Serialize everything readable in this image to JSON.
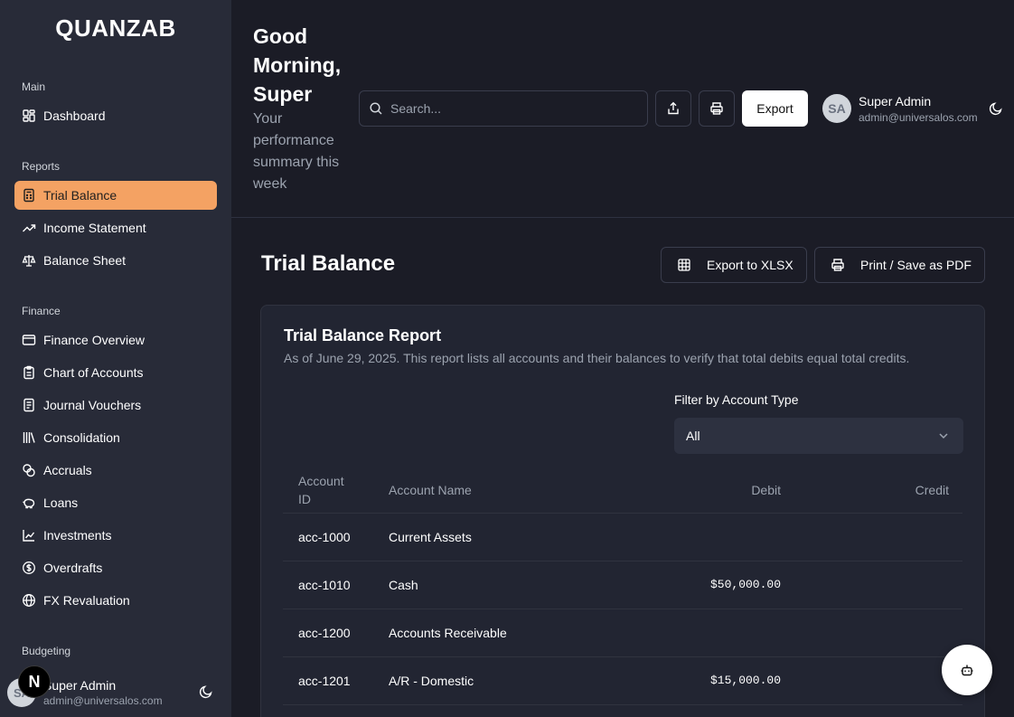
{
  "brand": "QUANZAB",
  "sidebar": {
    "sections": [
      {
        "label": "Main"
      },
      {
        "label": "Reports"
      },
      {
        "label": "Finance"
      },
      {
        "label": "Budgeting"
      }
    ],
    "items": [
      {
        "label": "Dashboard",
        "icon": "dashboard-icon"
      },
      {
        "label": "Trial Balance",
        "icon": "calculator-icon",
        "active": true
      },
      {
        "label": "Income Statement",
        "icon": "trending-up-icon"
      },
      {
        "label": "Balance Sheet",
        "icon": "scale-icon"
      },
      {
        "label": "Finance Overview",
        "icon": "wallet-icon"
      },
      {
        "label": "Chart of Accounts",
        "icon": "clipboard-list-icon"
      },
      {
        "label": "Journal Vouchers",
        "icon": "notebook-icon"
      },
      {
        "label": "Consolidation",
        "icon": "library-icon"
      },
      {
        "label": "Accruals",
        "icon": "coins-icon"
      },
      {
        "label": "Loans",
        "icon": "piggy-bank-icon"
      },
      {
        "label": "Investments",
        "icon": "line-chart-icon"
      },
      {
        "label": "Overdrafts",
        "icon": "circle-dollar-icon"
      },
      {
        "label": "FX Revaluation",
        "icon": "globe-icon"
      }
    ],
    "user": {
      "initials": "SA",
      "name": "Super Admin",
      "email": "admin@universalos.com"
    }
  },
  "header": {
    "greeting": "Good Morning, Super",
    "subtitle": "Your performance summary this week",
    "search_placeholder": "Search...",
    "export_label": "Export",
    "user": {
      "initials": "SA",
      "name": "Super Admin",
      "email": "admin@universalos.com"
    }
  },
  "main": {
    "title": "Trial Balance",
    "export_xlsx_label": "Export to XLSX",
    "print_label": "Print / Save as PDF",
    "card": {
      "title": "Trial Balance Report",
      "description": "As of June 29, 2025. This report lists all accounts and their balances to verify that total debits equal total credits.",
      "filter_label": "Filter by Account Type",
      "filter_value": "All",
      "columns": {
        "id": "Account ID",
        "name": "Account Name",
        "debit": "Debit",
        "credit": "Credit"
      },
      "rows": [
        {
          "id": "acc-1000",
          "name": "Current Assets",
          "debit": "",
          "credit": ""
        },
        {
          "id": "acc-1010",
          "name": "Cash",
          "debit": "$50,000.00",
          "credit": ""
        },
        {
          "id": "acc-1200",
          "name": "Accounts Receivable",
          "debit": "",
          "credit": ""
        },
        {
          "id": "acc-1201",
          "name": "A/R - Domestic",
          "debit": "$15,000.00",
          "credit": ""
        }
      ]
    }
  },
  "next_badge": "N",
  "colors": {
    "accent": "#f4a263",
    "sidebar_bg": "#282b38",
    "page_bg": "#1b1c26",
    "card_bg": "#222532"
  }
}
